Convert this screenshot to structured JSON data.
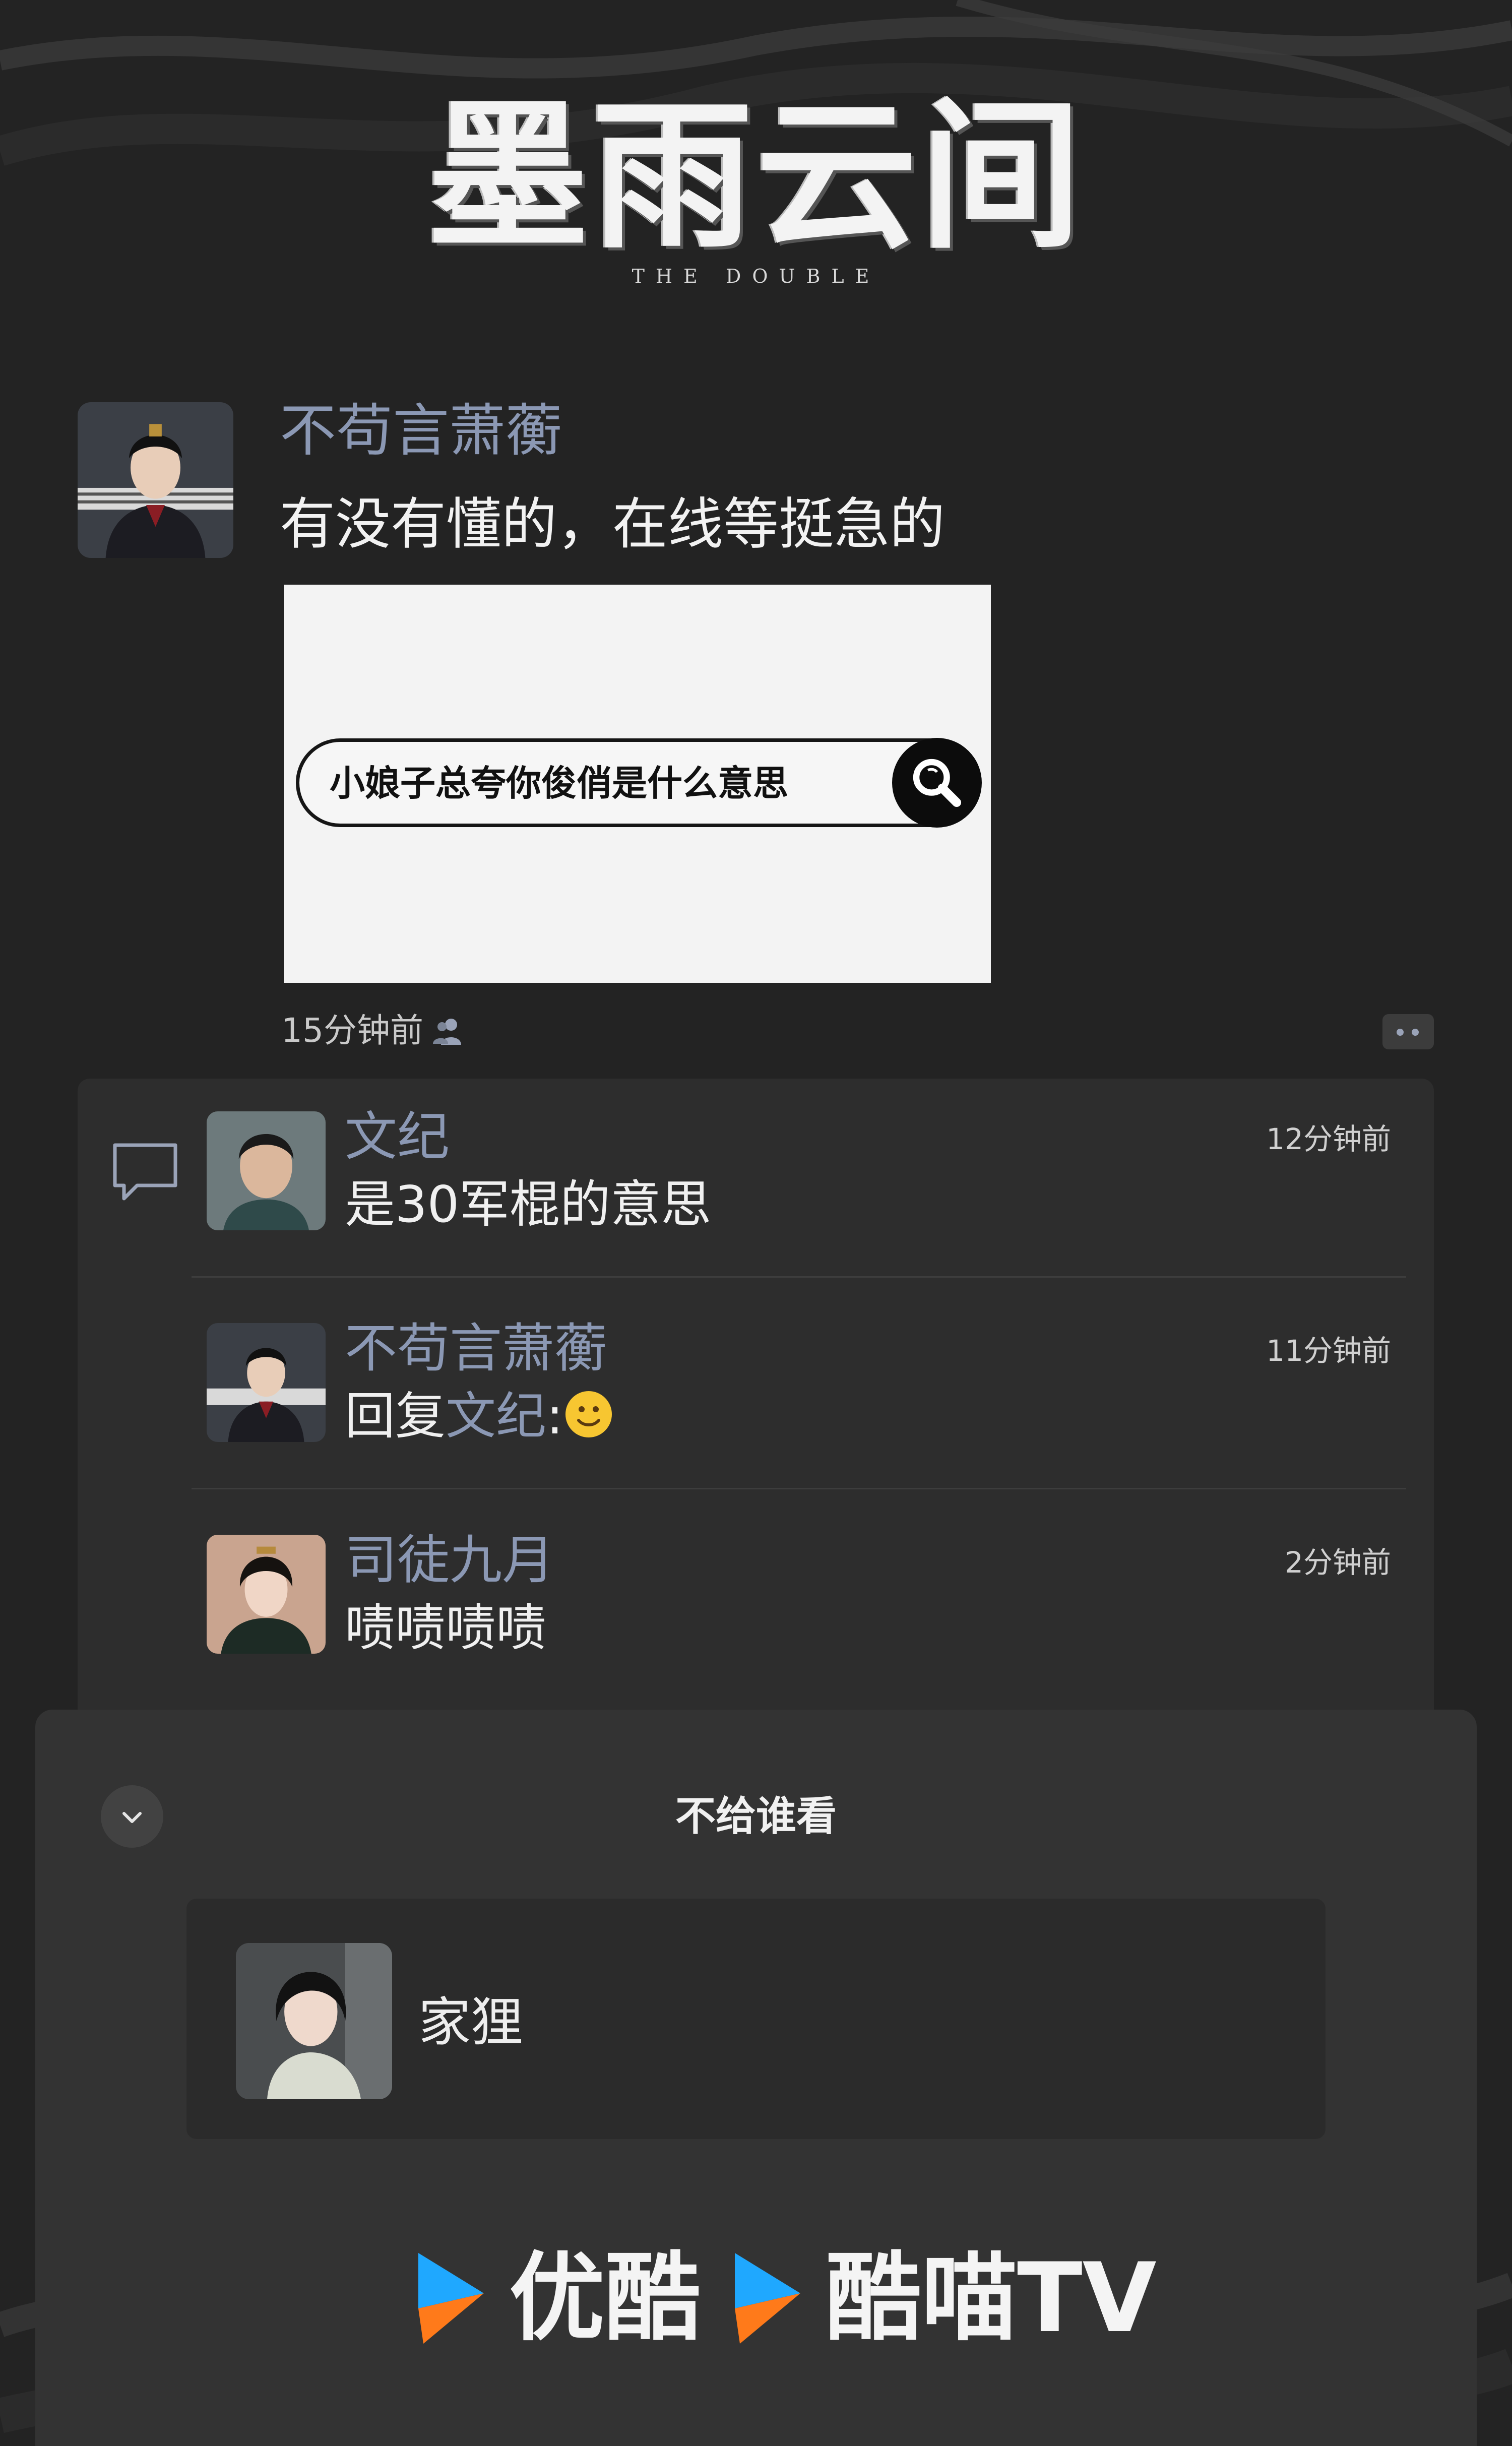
{
  "header": {
    "title": "墨雨云间",
    "subtitle": "THE DOUBLE"
  },
  "post": {
    "author": "不苟言萧蘅",
    "text": "有没有懂的，在线等挺急的",
    "image_search_text": "小娘子总夸你俊俏是什么意思",
    "time": "15分钟前"
  },
  "comments": [
    {
      "name": "文纪",
      "text": "是30军棍的意思",
      "time": "12分钟前"
    },
    {
      "name": "不苟言萧蘅",
      "reply_prefix": "回复",
      "reply_to": "文纪",
      "reply_suffix": ":",
      "time": "11分钟前"
    },
    {
      "name": "司徒九月",
      "text": "啧啧啧啧",
      "time": "2分钟前"
    }
  ],
  "sheet": {
    "title": "不给谁看",
    "selected_user": "家狸"
  },
  "brands": [
    {
      "name": "优酷"
    },
    {
      "name": "酷喵TV"
    }
  ],
  "icons": {
    "search": "search-icon",
    "friends": "friends-visibility-icon",
    "more": "more-dots-icon",
    "comment": "comment-icon",
    "collapse": "chevron-down-icon",
    "smile": "smile-emoji-icon"
  }
}
